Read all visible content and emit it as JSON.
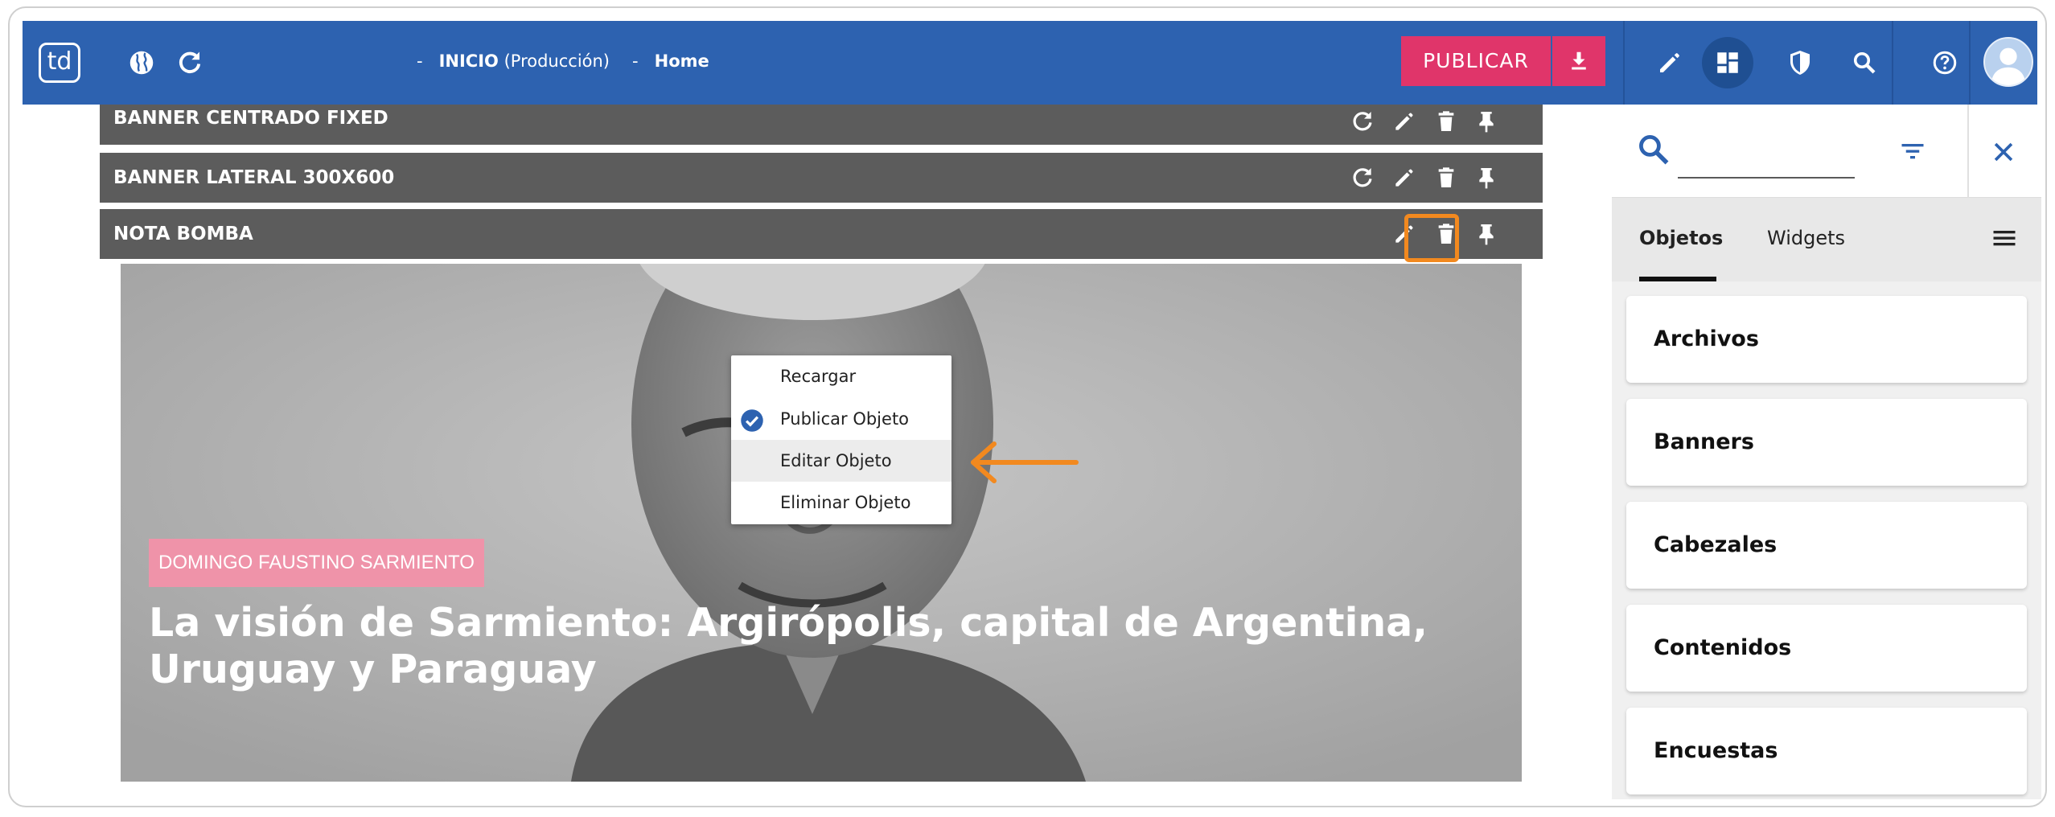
{
  "topbar": {
    "logo_text": "td",
    "breadcrumb": {
      "sep1": "-",
      "section": "INICIO",
      "env": "(Producción)",
      "sep2": "-",
      "page": "Home"
    },
    "publish_label": "PUBLICAR",
    "accent_color": "#2d62b0",
    "publish_color": "#e0356a"
  },
  "object_bars": [
    {
      "label": "BANNER CENTRADO FIXED"
    },
    {
      "label": "BANNER LATERAL 300X600"
    },
    {
      "label": "NOTA BOMBA"
    }
  ],
  "hero": {
    "tag": "DOMINGO FAUSTINO SARMIENTO",
    "headline": "La visión de Sarmiento: Argirópolis, capital de Argentina, Uruguay y Paraguay"
  },
  "context_menu": {
    "items": [
      {
        "label": "Recargar",
        "checked": false
      },
      {
        "label": "Publicar Objeto",
        "checked": true
      },
      {
        "label": "Editar Objeto",
        "checked": false,
        "hovered": true
      },
      {
        "label": "Eliminar Objeto",
        "checked": false
      }
    ]
  },
  "panel": {
    "search_value": "",
    "tabs": [
      {
        "label": "Objetos",
        "active": true
      },
      {
        "label": "Widgets",
        "active": false
      }
    ],
    "categories": [
      "Archivos",
      "Banners",
      "Cabezales",
      "Contenidos",
      "Encuestas"
    ]
  },
  "icons": [
    "globe-icon",
    "refresh-icon",
    "download-icon",
    "pencil-icon",
    "dashboard-icon",
    "shield-icon",
    "search-icon",
    "help-icon",
    "avatar-icon",
    "pin-icon",
    "trash-icon",
    "filter-icon",
    "close-icon",
    "menu-icon",
    "check-icon",
    "arrow-left-icon"
  ]
}
